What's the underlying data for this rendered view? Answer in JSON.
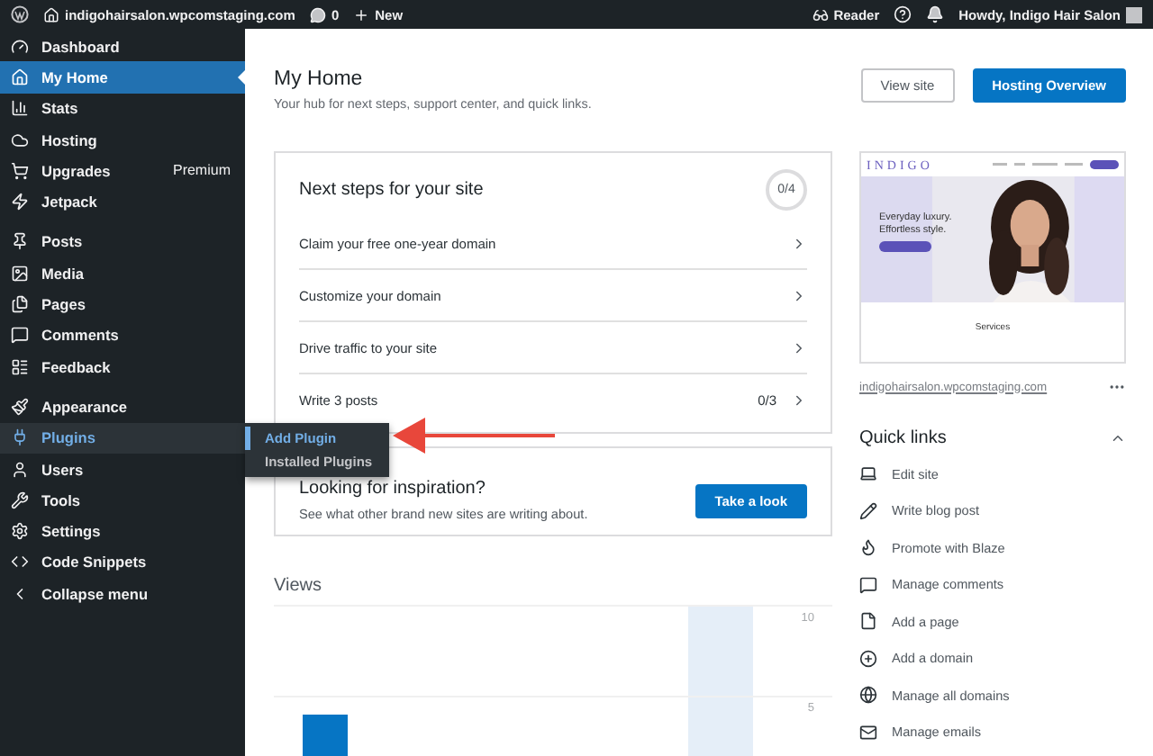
{
  "admin_bar": {
    "site": "indigohairsalon.wpcomstaging.com",
    "comments_count": "0",
    "new": "New",
    "reader": "Reader",
    "greeting": "Howdy, Indigo Hair Salon"
  },
  "sidebar": {
    "groups": [
      [
        {
          "label": "Dashboard",
          "selected": false,
          "hovered": false
        },
        {
          "label": "My Home",
          "selected": true,
          "hovered": false
        },
        {
          "label": "Stats",
          "selected": false,
          "hovered": false
        },
        {
          "label": "Hosting",
          "selected": false,
          "hovered": false
        },
        {
          "label": "Upgrades",
          "selected": false,
          "hovered": false,
          "badge": "Premium"
        },
        {
          "label": "Jetpack",
          "selected": false,
          "hovered": false
        }
      ],
      [
        {
          "label": "Posts",
          "selected": false,
          "hovered": false
        },
        {
          "label": "Media",
          "selected": false,
          "hovered": false
        },
        {
          "label": "Pages",
          "selected": false,
          "hovered": false
        },
        {
          "label": "Comments",
          "selected": false,
          "hovered": false
        },
        {
          "label": "Feedback",
          "selected": false,
          "hovered": false
        }
      ],
      [
        {
          "label": "Appearance",
          "selected": false,
          "hovered": false
        },
        {
          "label": "Plugins",
          "selected": false,
          "hovered": true,
          "submenu": [
            {
              "label": "Add Plugin",
              "selected": true
            },
            {
              "label": "Installed Plugins",
              "selected": false
            }
          ]
        },
        {
          "label": "Users",
          "selected": false,
          "hovered": false
        },
        {
          "label": "Tools",
          "selected": false,
          "hovered": false
        },
        {
          "label": "Settings",
          "selected": false,
          "hovered": false
        },
        {
          "label": "Code Snippets",
          "selected": false,
          "hovered": false
        },
        {
          "label": "Collapse menu",
          "selected": false,
          "hovered": false
        }
      ]
    ]
  },
  "header": {
    "title": "My Home",
    "subtitle": "Your hub for next steps, support center, and quick links.",
    "buttons": [
      {
        "label": "View site",
        "primary": false
      },
      {
        "label": "Hosting Overview",
        "primary": true
      }
    ]
  },
  "next_steps": {
    "title": "Next steps for your site",
    "progress": "0/4",
    "rows": [
      {
        "label": "Claim your free one-year domain"
      },
      {
        "label": "Customize your domain"
      },
      {
        "label": "Drive traffic to your site"
      },
      {
        "label": "Write 3 posts",
        "count": "0/3"
      }
    ]
  },
  "inspiration": {
    "title": "Looking for inspiration?",
    "text": "See what other brand new sites are writing about.",
    "button": "Take a look"
  },
  "views": {
    "title": "Views",
    "axis_labels": [
      "10",
      "5"
    ]
  },
  "preview": {
    "brand": "INDIGO",
    "tagline": [
      "Everyday luxury.",
      "Effortless style."
    ],
    "section": "Services",
    "url": "indigohairsalon.wpcomstaging.com"
  },
  "quick_links": {
    "title": "Quick links",
    "expanded": true,
    "items": [
      {
        "label": "Edit site"
      },
      {
        "label": "Write blog post"
      },
      {
        "label": "Promote with Blaze"
      },
      {
        "label": "Manage comments"
      },
      {
        "label": "Add a page"
      },
      {
        "label": "Add a domain"
      },
      {
        "label": "Manage all domains"
      },
      {
        "label": "Manage emails"
      }
    ]
  }
}
